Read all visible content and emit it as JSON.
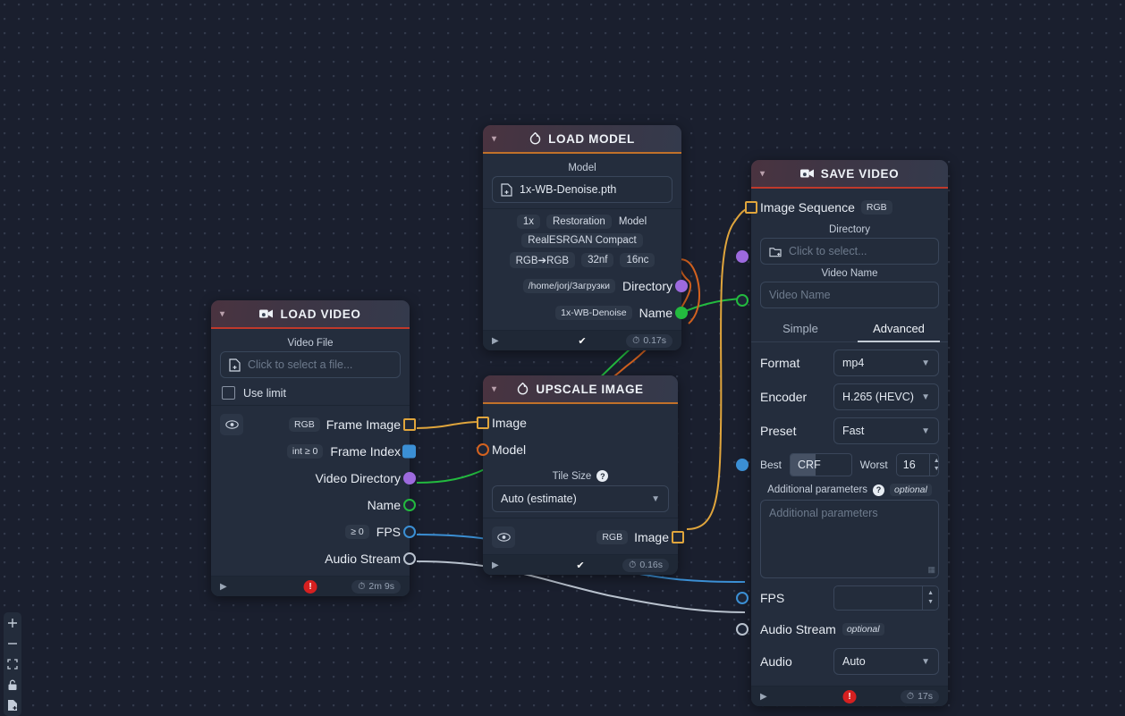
{
  "app": {
    "background_color": "#1a1f2e",
    "node_color": "#242d3d"
  },
  "toolbar": {
    "items": [
      {
        "name": "zoom-in-icon",
        "label": "+"
      },
      {
        "name": "zoom-out-icon",
        "label": "–"
      },
      {
        "name": "fit-view-icon",
        "label": "⬚"
      },
      {
        "name": "lock-icon",
        "label": "🔒"
      },
      {
        "name": "add-node-icon",
        "label": "🗎"
      }
    ]
  },
  "nodes": {
    "load_video": {
      "title": "LOAD VIDEO",
      "accent": "#c0392b",
      "icon": "video-camera-icon",
      "file_label": "Video File",
      "file_placeholder": "Click to select a file...",
      "use_limit_label": "Use limit",
      "outputs": [
        {
          "label": "Frame Image",
          "tag": "RGB",
          "socket": "image-square-orange"
        },
        {
          "label": "Frame Index",
          "tag": "int ≥ 0",
          "socket": "filled-blue-square"
        },
        {
          "label": "Video Directory",
          "tag": "",
          "socket": "filled-purple-circle"
        },
        {
          "label": "Name",
          "tag": "",
          "socket": "ring-green-circle"
        },
        {
          "label": "FPS",
          "tag": "≥ 0",
          "socket": "ring-blue-circle"
        },
        {
          "label": "Audio Stream",
          "tag": "",
          "socket": "ring-grey-circle"
        }
      ],
      "footer": {
        "status": "error",
        "error_mark": "!",
        "time": "2m 9s"
      }
    },
    "load_model": {
      "title": "LOAD MODEL",
      "accent": "#c1712a",
      "icon": "pytorch-flame-icon",
      "model_label": "Model",
      "model_value": "1x-WB-Denoise.pth",
      "tags_row1": [
        "1x",
        "Restoration",
        "Model"
      ],
      "tags_row2": [
        "RealESRGAN Compact"
      ],
      "tags_row3": [
        "RGB➔RGB",
        "32nf",
        "16nc"
      ],
      "outputs": [
        {
          "label": "Directory",
          "tag": "/home/jorj/Загрузки",
          "socket": "filled-purple-circle"
        },
        {
          "label": "Name",
          "tag": "1x-WB-Denoise",
          "socket": "filled-green-circle"
        }
      ],
      "footer": {
        "status": "ok",
        "check": "✔",
        "time": "0.17s"
      }
    },
    "upscale_image": {
      "title": "UPSCALE IMAGE",
      "accent": "#c1712a",
      "icon": "pytorch-flame-icon",
      "inputs": [
        {
          "label": "Image",
          "socket": "image-square-orange"
        },
        {
          "label": "Model",
          "socket": "ring-orange-circle"
        }
      ],
      "tile_size_label": "Tile Size",
      "tile_size_value": "Auto (estimate)",
      "outputs": [
        {
          "label": "Image",
          "tag": "RGB",
          "socket": "image-square-orange"
        }
      ],
      "footer": {
        "status": "ok",
        "check": "✔",
        "time": "0.16s"
      }
    },
    "save_video": {
      "title": "SAVE VIDEO",
      "accent": "#c0392b",
      "icon": "video-camera-icon",
      "image_sequence_label": "Image Sequence",
      "image_sequence_tag": "RGB",
      "directory_label": "Directory",
      "directory_placeholder": "Click to select...",
      "video_name_label": "Video Name",
      "video_name_placeholder": "Video Name",
      "tabs": [
        {
          "label": "Simple",
          "active": false
        },
        {
          "label": "Advanced",
          "active": true
        }
      ],
      "format_label": "Format",
      "format_value": "mp4",
      "encoder_label": "Encoder",
      "encoder_value": "H.265 (HEVC)",
      "preset_label": "Preset",
      "preset_value": "Fast",
      "crf": {
        "best_label": "Best",
        "value_text": "CRF",
        "worst_label": "Worst",
        "worst_value": "16"
      },
      "additional_params_label": "Additional parameters",
      "additional_params_optional": "optional",
      "additional_params_placeholder": "Additional parameters",
      "fps_label": "FPS",
      "fps_value": "",
      "audio_stream_label": "Audio Stream",
      "audio_stream_optional": "optional",
      "audio_label": "Audio",
      "audio_value": "Auto",
      "footer": {
        "status": "error",
        "error_mark": "!",
        "time": "17s"
      }
    }
  },
  "edge_colors": {
    "image": "#e0a53c",
    "model": "#d4621f",
    "name": "#23ba3f",
    "fps": "#3b8fd4",
    "audio": "#b9c2ce"
  }
}
